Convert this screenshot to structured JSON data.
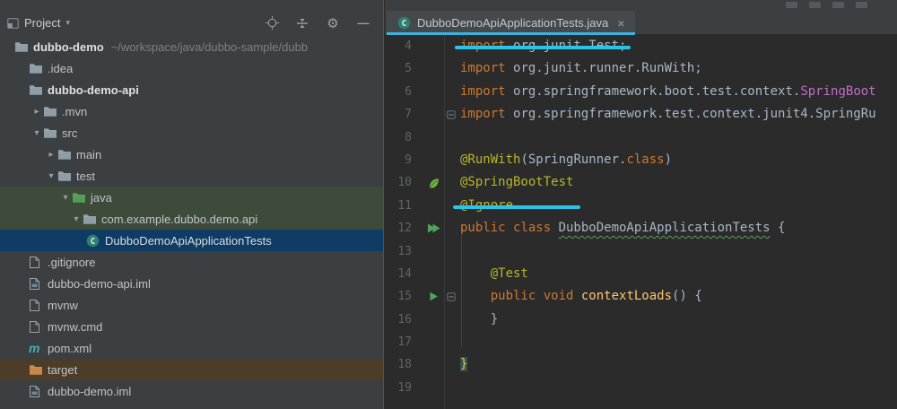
{
  "project_panel": {
    "title": "Project",
    "caret": "▾",
    "header_icons": [
      {
        "name": "locate-icon"
      },
      {
        "name": "collapse-all-icon"
      },
      {
        "name": "settings-icon"
      },
      {
        "name": "hide-icon"
      }
    ],
    "tree": [
      {
        "label": "dubbo-demo",
        "suffix": "~/workspace/java/dubbo-sample/dubb",
        "icon": "folder",
        "arrow": "none",
        "indent": 0,
        "bold": true
      },
      {
        "label": ".idea",
        "icon": "folder",
        "arrow": "none",
        "indent": 1
      },
      {
        "label": "dubbo-demo-api",
        "icon": "folder",
        "arrow": "none",
        "indent": 1,
        "bold": true
      },
      {
        "label": ".mvn",
        "icon": "folder",
        "arrow": "collapsed",
        "indent": 2
      },
      {
        "label": "src",
        "icon": "folder",
        "arrow": "expanded",
        "indent": 2
      },
      {
        "label": "main",
        "icon": "folder",
        "arrow": "collapsed",
        "indent": 3
      },
      {
        "label": "test",
        "icon": "folder",
        "arrow": "expanded",
        "indent": 3
      },
      {
        "label": "java",
        "icon": "folder-test",
        "arrow": "expanded",
        "indent": 4,
        "style": "test"
      },
      {
        "label": "com.example.dubbo.demo.api",
        "icon": "package",
        "arrow": "expanded",
        "indent": 5,
        "style": "test"
      },
      {
        "label": "DubboDemoApiApplicationTests",
        "icon": "class",
        "arrow": "none",
        "indent": 6,
        "style": "sel"
      },
      {
        "label": ".gitignore",
        "icon": "file",
        "arrow": "none",
        "indent": 1
      },
      {
        "label": "dubbo-demo-api.iml",
        "icon": "file-iml",
        "arrow": "none",
        "indent": 1
      },
      {
        "label": "mvnw",
        "icon": "file",
        "arrow": "none",
        "indent": 1
      },
      {
        "label": "mvnw.cmd",
        "icon": "file",
        "arrow": "none",
        "indent": 1
      },
      {
        "label": "pom.xml",
        "icon": "maven",
        "arrow": "none",
        "indent": 1
      },
      {
        "label": "target",
        "icon": "folder-excluded",
        "arrow": "none",
        "indent": 1,
        "style": "excl"
      },
      {
        "label": "dubbo-demo.iml",
        "icon": "file-iml",
        "arrow": "none",
        "indent": 1
      }
    ]
  },
  "editor": {
    "tab": {
      "label": "DubboDemoApiApplicationTests.java",
      "close_glyph": "×",
      "icon": "test-class-icon"
    },
    "colors": {
      "marker_cyan": "#2cc3e8",
      "tab_underline": "#3ab2e0"
    },
    "marker_underlines": [
      {
        "line": 4,
        "x": 78,
        "w": 196
      },
      {
        "line": 11,
        "x": 76,
        "w": 142
      }
    ],
    "lines": [
      {
        "num": "4",
        "code": [
          [
            "k",
            "import "
          ],
          [
            "d",
            "org.junit.Test;"
          ]
        ]
      },
      {
        "num": "5",
        "code": [
          [
            "k",
            "import "
          ],
          [
            "d",
            "org.junit.runner.RunWith;"
          ]
        ]
      },
      {
        "num": "6",
        "code": [
          [
            "k",
            "import "
          ],
          [
            "d",
            "org.springframework.boot.test.context."
          ],
          [
            "p",
            "SpringBoot"
          ]
        ]
      },
      {
        "num": "7",
        "fold": "minus",
        "code": [
          [
            "k",
            "import "
          ],
          [
            "d",
            "org.springframework.test.context.junit4.SpringRu"
          ]
        ]
      },
      {
        "num": "8",
        "code": []
      },
      {
        "num": "9",
        "code": [
          [
            "a",
            "@RunWith"
          ],
          [
            "d",
            "("
          ],
          [
            "d",
            "SpringRunner."
          ],
          [
            "k",
            "class"
          ],
          [
            "d",
            ")"
          ]
        ]
      },
      {
        "num": "10",
        "gutter": "spring-leaf",
        "code": [
          [
            "a",
            "@SpringBootTest"
          ]
        ]
      },
      {
        "num": "11",
        "code": [
          [
            "a",
            "@Ignore"
          ]
        ]
      },
      {
        "num": "12",
        "gutter": "run-all",
        "code": [
          [
            "k",
            "public class "
          ],
          [
            "w",
            "DubboDemoApiApplicationTests"
          ],
          [
            "d",
            " {"
          ]
        ]
      },
      {
        "num": "13",
        "code": []
      },
      {
        "num": "14",
        "code": [
          [
            "d",
            "    "
          ],
          [
            "a",
            "@Test"
          ]
        ]
      },
      {
        "num": "15",
        "gutter": "run",
        "fold": "minus",
        "code": [
          [
            "d",
            "    "
          ],
          [
            "k",
            "public void "
          ],
          [
            "m",
            "contextLoads"
          ],
          [
            "d",
            "() {"
          ]
        ]
      },
      {
        "num": "16",
        "code": [
          [
            "d",
            "    }"
          ]
        ]
      },
      {
        "num": "17",
        "code": []
      },
      {
        "num": "18",
        "code": [
          [
            "h",
            "}"
          ]
        ]
      },
      {
        "num": "19",
        "code": []
      }
    ]
  }
}
